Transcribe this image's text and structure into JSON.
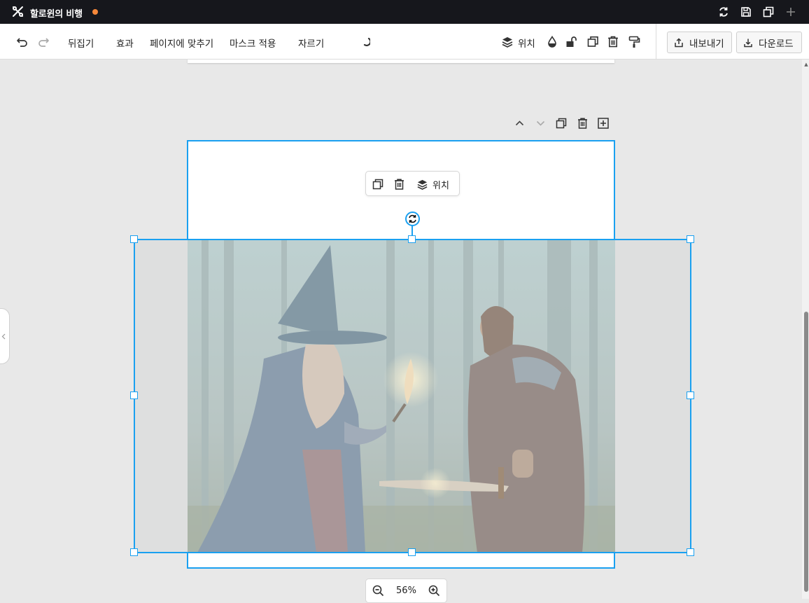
{
  "window": {
    "title": "할로윈의 비행",
    "unsaved_indicator_color": "#f6883a",
    "actions": [
      "refresh-icon",
      "save-icon",
      "duplicate-window-icon",
      "plus-icon"
    ]
  },
  "toolbar": {
    "undo_icon": "undo-icon",
    "redo_icon": "redo-icon",
    "flip_label": "뒤집기",
    "effects_label": "효과",
    "fit_page_label": "페이지에 맞추기",
    "apply_mask_label": "마스크 적용",
    "crop_label": "자르기",
    "position_label": "위치",
    "export_label": "내보내기",
    "download_label": "다운로드"
  },
  "page_toolbar": {
    "icons": [
      "chevron-up-icon",
      "chevron-down-icon",
      "duplicate-icon",
      "trash-icon",
      "add-page-icon"
    ]
  },
  "floating_toolbar": {
    "position_label": "위치"
  },
  "canvas": {
    "accent_color": "#1aa0f0",
    "image_subject": "wizard and warrior in misty forest"
  },
  "zoom": {
    "level": "56%"
  }
}
